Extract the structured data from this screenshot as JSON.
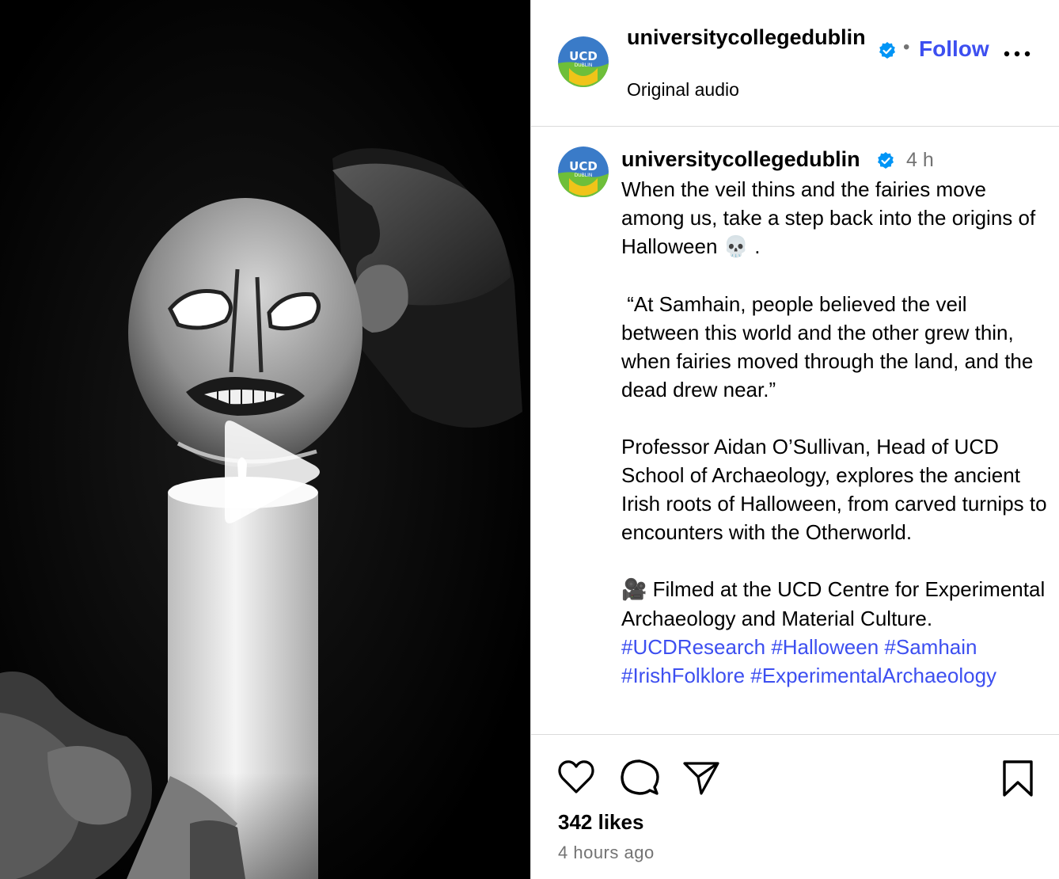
{
  "account": {
    "username": "universitycollegedublin",
    "avatar_text": "UCD",
    "avatar_subtext": "DUBLIN",
    "verified": true
  },
  "header": {
    "separator": "•",
    "follow_label": "Follow",
    "audio_label": "Original audio"
  },
  "caption": {
    "time": "4 h",
    "line1": "When the veil thins and the fairies move among us, take a step back into the origins of Halloween ",
    "line1_emoji": "💀",
    "line1_end": " .",
    "quote": " “At Samhain, people believed the veil between this world and the other grew thin, when fairies moved through the land, and the dead drew near.”",
    "para2": "Professor Aidan O’Sullivan, Head of UCD School of Archaeology, explores the ancient Irish roots of Halloween, from carved turnips to encounters with the Otherworld.",
    "para3_emoji": "🎥",
    "para3": " Filmed at the UCD Centre for Experimental Archaeology and Material Culture. ",
    "hashtags": [
      "#UCDResearch",
      "#Halloween",
      "#Samhain",
      "#IrishFolklore",
      "#ExperimentalArchaeology"
    ]
  },
  "stats": {
    "likes": "342 likes",
    "posted": "4 hours ago"
  },
  "icons": {
    "like": "heart-icon",
    "comment": "comment-icon",
    "share": "send-icon",
    "save": "bookmark-icon",
    "more": "more-icon",
    "play": "play-icon",
    "verified": "verified-badge-icon"
  },
  "colors": {
    "link_blue": "#3d4ff0",
    "verified_blue": "#0095f6",
    "secondary_text": "#737373",
    "divider": "#dbdbdb"
  }
}
